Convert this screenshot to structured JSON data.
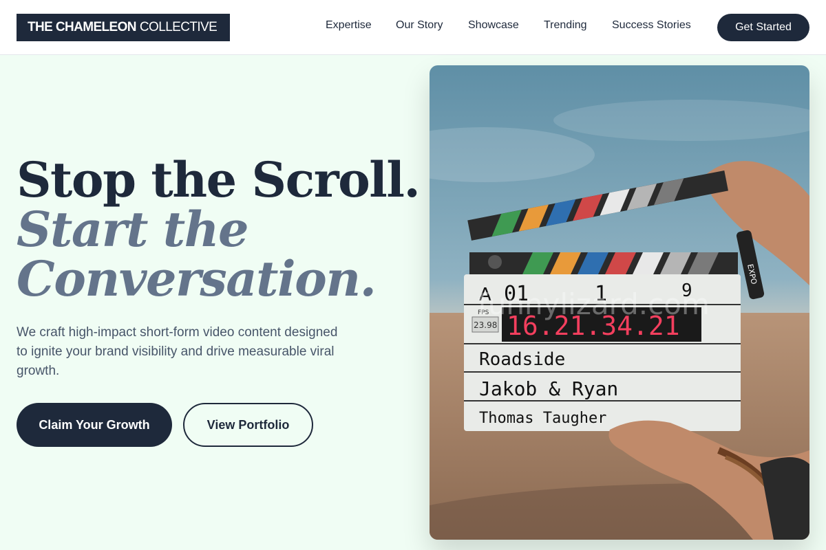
{
  "brand": {
    "bold": "THE CHAMELEON",
    "light": "COLLECTIVE"
  },
  "nav": {
    "items": [
      "Expertise",
      "Our Story",
      "Showcase",
      "Trending",
      "Success Stories"
    ],
    "cta": "Get Started"
  },
  "hero": {
    "line1": "Stop the Scroll.",
    "line2": "Start the",
    "line3": "Conversation.",
    "subtitle": "We craft high-impact short-form video content designed to ignite your brand visibility and drive measurable viral growth.",
    "primary_cta": "Claim Your Growth",
    "secondary_cta": "View Portfolio"
  },
  "image": {
    "slate": {
      "roll": "A",
      "scene": "01",
      "take_left": "1",
      "take_right": "9",
      "fps_label": "FPS",
      "fps": "23.98",
      "timecode": "16.21.34.21",
      "prod": "Roadside",
      "director": "Jakob & Ryan",
      "camera": "Thomas Taugher",
      "marker_brand": "EXPO"
    },
    "watermark": "funnylizard.com"
  },
  "colors": {
    "primary": "#1e293b",
    "muted": "#64748b",
    "background": "#f0fdf4",
    "timecode": "#f43f5e"
  }
}
